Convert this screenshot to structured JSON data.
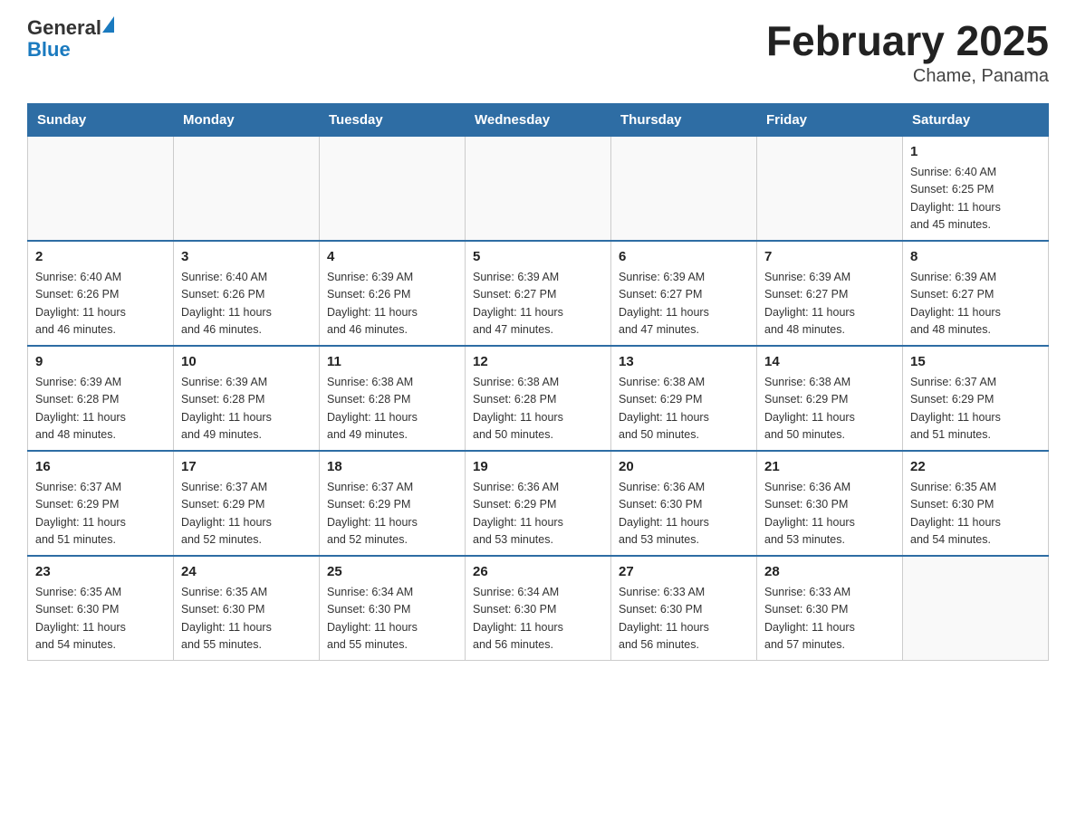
{
  "header": {
    "logo_general": "General",
    "logo_blue": "Blue",
    "month_title": "February 2025",
    "location": "Chame, Panama"
  },
  "weekdays": [
    "Sunday",
    "Monday",
    "Tuesday",
    "Wednesday",
    "Thursday",
    "Friday",
    "Saturday"
  ],
  "weeks": [
    [
      {
        "day": "",
        "info": ""
      },
      {
        "day": "",
        "info": ""
      },
      {
        "day": "",
        "info": ""
      },
      {
        "day": "",
        "info": ""
      },
      {
        "day": "",
        "info": ""
      },
      {
        "day": "",
        "info": ""
      },
      {
        "day": "1",
        "info": "Sunrise: 6:40 AM\nSunset: 6:25 PM\nDaylight: 11 hours\nand 45 minutes."
      }
    ],
    [
      {
        "day": "2",
        "info": "Sunrise: 6:40 AM\nSunset: 6:26 PM\nDaylight: 11 hours\nand 46 minutes."
      },
      {
        "day": "3",
        "info": "Sunrise: 6:40 AM\nSunset: 6:26 PM\nDaylight: 11 hours\nand 46 minutes."
      },
      {
        "day": "4",
        "info": "Sunrise: 6:39 AM\nSunset: 6:26 PM\nDaylight: 11 hours\nand 46 minutes."
      },
      {
        "day": "5",
        "info": "Sunrise: 6:39 AM\nSunset: 6:27 PM\nDaylight: 11 hours\nand 47 minutes."
      },
      {
        "day": "6",
        "info": "Sunrise: 6:39 AM\nSunset: 6:27 PM\nDaylight: 11 hours\nand 47 minutes."
      },
      {
        "day": "7",
        "info": "Sunrise: 6:39 AM\nSunset: 6:27 PM\nDaylight: 11 hours\nand 48 minutes."
      },
      {
        "day": "8",
        "info": "Sunrise: 6:39 AM\nSunset: 6:27 PM\nDaylight: 11 hours\nand 48 minutes."
      }
    ],
    [
      {
        "day": "9",
        "info": "Sunrise: 6:39 AM\nSunset: 6:28 PM\nDaylight: 11 hours\nand 48 minutes."
      },
      {
        "day": "10",
        "info": "Sunrise: 6:39 AM\nSunset: 6:28 PM\nDaylight: 11 hours\nand 49 minutes."
      },
      {
        "day": "11",
        "info": "Sunrise: 6:38 AM\nSunset: 6:28 PM\nDaylight: 11 hours\nand 49 minutes."
      },
      {
        "day": "12",
        "info": "Sunrise: 6:38 AM\nSunset: 6:28 PM\nDaylight: 11 hours\nand 50 minutes."
      },
      {
        "day": "13",
        "info": "Sunrise: 6:38 AM\nSunset: 6:29 PM\nDaylight: 11 hours\nand 50 minutes."
      },
      {
        "day": "14",
        "info": "Sunrise: 6:38 AM\nSunset: 6:29 PM\nDaylight: 11 hours\nand 50 minutes."
      },
      {
        "day": "15",
        "info": "Sunrise: 6:37 AM\nSunset: 6:29 PM\nDaylight: 11 hours\nand 51 minutes."
      }
    ],
    [
      {
        "day": "16",
        "info": "Sunrise: 6:37 AM\nSunset: 6:29 PM\nDaylight: 11 hours\nand 51 minutes."
      },
      {
        "day": "17",
        "info": "Sunrise: 6:37 AM\nSunset: 6:29 PM\nDaylight: 11 hours\nand 52 minutes."
      },
      {
        "day": "18",
        "info": "Sunrise: 6:37 AM\nSunset: 6:29 PM\nDaylight: 11 hours\nand 52 minutes."
      },
      {
        "day": "19",
        "info": "Sunrise: 6:36 AM\nSunset: 6:29 PM\nDaylight: 11 hours\nand 53 minutes."
      },
      {
        "day": "20",
        "info": "Sunrise: 6:36 AM\nSunset: 6:30 PM\nDaylight: 11 hours\nand 53 minutes."
      },
      {
        "day": "21",
        "info": "Sunrise: 6:36 AM\nSunset: 6:30 PM\nDaylight: 11 hours\nand 53 minutes."
      },
      {
        "day": "22",
        "info": "Sunrise: 6:35 AM\nSunset: 6:30 PM\nDaylight: 11 hours\nand 54 minutes."
      }
    ],
    [
      {
        "day": "23",
        "info": "Sunrise: 6:35 AM\nSunset: 6:30 PM\nDaylight: 11 hours\nand 54 minutes."
      },
      {
        "day": "24",
        "info": "Sunrise: 6:35 AM\nSunset: 6:30 PM\nDaylight: 11 hours\nand 55 minutes."
      },
      {
        "day": "25",
        "info": "Sunrise: 6:34 AM\nSunset: 6:30 PM\nDaylight: 11 hours\nand 55 minutes."
      },
      {
        "day": "26",
        "info": "Sunrise: 6:34 AM\nSunset: 6:30 PM\nDaylight: 11 hours\nand 56 minutes."
      },
      {
        "day": "27",
        "info": "Sunrise: 6:33 AM\nSunset: 6:30 PM\nDaylight: 11 hours\nand 56 minutes."
      },
      {
        "day": "28",
        "info": "Sunrise: 6:33 AM\nSunset: 6:30 PM\nDaylight: 11 hours\nand 57 minutes."
      },
      {
        "day": "",
        "info": ""
      }
    ]
  ]
}
